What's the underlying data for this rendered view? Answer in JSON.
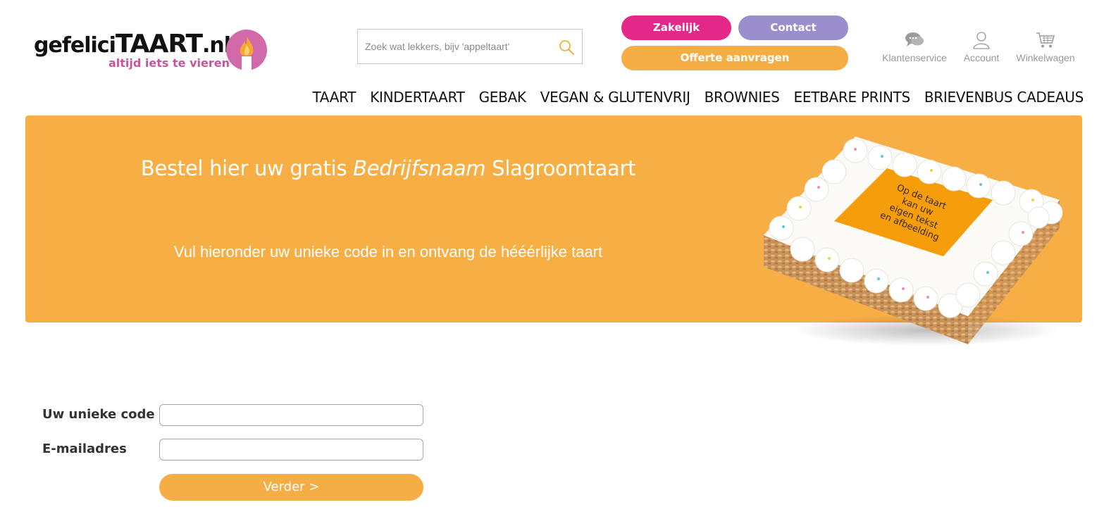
{
  "header": {
    "logo": {
      "text_prefix": "gefelici",
      "text_main": "TAART",
      "text_suffix": ".nl",
      "tagline": "altijd iets te vieren",
      "badge_color": "#d26aa9",
      "tagline_color": "#c8559c"
    },
    "search": {
      "placeholder": "Zoek wat lekkers, bijv 'appeltaart'",
      "value": "",
      "icon": "search-icon"
    },
    "buttons": {
      "zakelijk": "Zakelijk",
      "contact": "Contact",
      "offerte": "Offerte aanvragen"
    },
    "utility": [
      {
        "label": "Klantenservice",
        "icon": "chat-icon"
      },
      {
        "label": "Account",
        "icon": "user-icon"
      },
      {
        "label": "Winkelwagen",
        "icon": "cart-icon"
      }
    ]
  },
  "nav": {
    "items": [
      "TAART",
      "KINDERTAART",
      "GEBAK",
      "VEGAN & GLUTENVRIJ",
      "BROWNIES",
      "EETBARE PRINTS",
      "BRIEVENBUS CADEAUS"
    ]
  },
  "banner": {
    "title_start": "Bestel hier uw gratis ",
    "title_italic": "Bedrijfsnaam",
    "title_end": " Slagroomtaart",
    "subtitle": "Vul hieronder uw unieke code in en ontvang de hééérlijke taart",
    "cake_text": [
      "Op de taart",
      "kan uw",
      "eigen tekst",
      "en afbeelding"
    ],
    "background": "#f7af45"
  },
  "form": {
    "code_label": "Uw unieke code",
    "code_value": "",
    "email_label": "E-mailadres",
    "email_value": "",
    "submit_label": "Verder >"
  },
  "colors": {
    "pink": "#e3288a",
    "lavender": "#9a8fcc",
    "orange": "#f5ae45"
  }
}
